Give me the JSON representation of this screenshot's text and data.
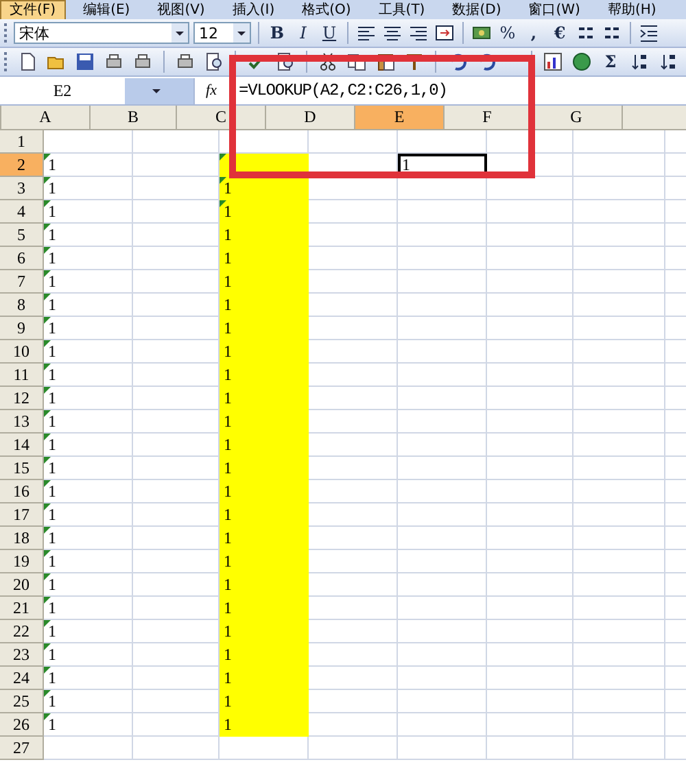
{
  "menu": [
    {
      "label": "文件(F)",
      "selected": true
    },
    {
      "label": "编辑(E)",
      "selected": false
    },
    {
      "label": "视图(V)",
      "selected": false
    },
    {
      "label": "插入(I)",
      "selected": false
    },
    {
      "label": "格式(O)",
      "selected": false
    },
    {
      "label": "工具(T)",
      "selected": false
    },
    {
      "label": "数据(D)",
      "selected": false
    },
    {
      "label": "窗口(W)",
      "selected": false
    },
    {
      "label": "帮助(H)",
      "selected": false
    }
  ],
  "format_toolbar": {
    "font": "宋体",
    "size": "12",
    "bold": "B",
    "italic": "I",
    "underline": "U",
    "percent": "%",
    "comma": ",",
    "euro": "€"
  },
  "standard_toolbar": {
    "autosum": "Σ"
  },
  "formula_bar": {
    "name_box": "E2",
    "fx": "fx",
    "formula": "=VLOOKUP(A2,C2:C26,1,0)"
  },
  "columns": [
    {
      "label": "A",
      "selected": false
    },
    {
      "label": "B",
      "selected": false
    },
    {
      "label": "C",
      "selected": false
    },
    {
      "label": "D",
      "selected": false
    },
    {
      "label": "E",
      "selected": true
    },
    {
      "label": "F",
      "selected": false
    },
    {
      "label": "G",
      "selected": false
    }
  ],
  "rows": [
    {
      "label": "1",
      "selected": false,
      "cells": {}
    },
    {
      "label": "2",
      "selected": true,
      "cells": {
        "A": {
          "text": "1",
          "flag": true
        },
        "C": {
          "flag": true,
          "highlighted": true
        },
        "E": {
          "text": "1",
          "active": true
        }
      }
    },
    {
      "label": "3",
      "selected": false,
      "cells": {
        "A": {
          "text": "1",
          "flag": true
        },
        "C": {
          "text": "1",
          "flag": true,
          "highlighted": true
        }
      }
    },
    {
      "label": "4",
      "selected": false,
      "cells": {
        "A": {
          "text": "1",
          "flag": true
        },
        "C": {
          "text": "1",
          "flag": true,
          "highlighted": true
        }
      }
    },
    {
      "label": "5",
      "selected": false,
      "cells": {
        "A": {
          "text": "1",
          "flag": true
        },
        "C": {
          "text": "1",
          "highlighted": true
        }
      }
    },
    {
      "label": "6",
      "selected": false,
      "cells": {
        "A": {
          "text": "1",
          "flag": true
        },
        "C": {
          "text": "1",
          "highlighted": true
        }
      }
    },
    {
      "label": "7",
      "selected": false,
      "cells": {
        "A": {
          "text": "1",
          "flag": true
        },
        "C": {
          "text": "1",
          "highlighted": true
        }
      }
    },
    {
      "label": "8",
      "selected": false,
      "cells": {
        "A": {
          "text": "1",
          "flag": true
        },
        "C": {
          "text": "1",
          "highlighted": true
        }
      }
    },
    {
      "label": "9",
      "selected": false,
      "cells": {
        "A": {
          "text": "1",
          "flag": true
        },
        "C": {
          "text": "1",
          "highlighted": true
        }
      }
    },
    {
      "label": "10",
      "selected": false,
      "cells": {
        "A": {
          "text": "1",
          "flag": true
        },
        "C": {
          "text": "1",
          "highlighted": true
        }
      }
    },
    {
      "label": "11",
      "selected": false,
      "cells": {
        "A": {
          "text": "1",
          "flag": true
        },
        "C": {
          "text": "1",
          "highlighted": true
        }
      }
    },
    {
      "label": "12",
      "selected": false,
      "cells": {
        "A": {
          "text": "1",
          "flag": true
        },
        "C": {
          "text": "1",
          "highlighted": true
        }
      }
    },
    {
      "label": "13",
      "selected": false,
      "cells": {
        "A": {
          "text": "1",
          "flag": true
        },
        "C": {
          "text": "1",
          "highlighted": true
        }
      }
    },
    {
      "label": "14",
      "selected": false,
      "cells": {
        "A": {
          "text": "1",
          "flag": true
        },
        "C": {
          "text": "1",
          "highlighted": true
        }
      }
    },
    {
      "label": "15",
      "selected": false,
      "cells": {
        "A": {
          "text": "1",
          "flag": true
        },
        "C": {
          "text": "1",
          "highlighted": true
        }
      }
    },
    {
      "label": "16",
      "selected": false,
      "cells": {
        "A": {
          "text": "1",
          "flag": true
        },
        "C": {
          "text": "1",
          "highlighted": true
        }
      }
    },
    {
      "label": "17",
      "selected": false,
      "cells": {
        "A": {
          "text": "1",
          "flag": true
        },
        "C": {
          "text": "1",
          "highlighted": true
        }
      }
    },
    {
      "label": "18",
      "selected": false,
      "cells": {
        "A": {
          "text": "1",
          "flag": true
        },
        "C": {
          "text": "1",
          "highlighted": true
        }
      }
    },
    {
      "label": "19",
      "selected": false,
      "cells": {
        "A": {
          "text": "1",
          "flag": true
        },
        "C": {
          "text": "1",
          "highlighted": true
        }
      }
    },
    {
      "label": "20",
      "selected": false,
      "cells": {
        "A": {
          "text": "1",
          "flag": true
        },
        "C": {
          "text": "1",
          "highlighted": true
        }
      }
    },
    {
      "label": "21",
      "selected": false,
      "cells": {
        "A": {
          "text": "1",
          "flag": true
        },
        "C": {
          "text": "1",
          "highlighted": true
        }
      }
    },
    {
      "label": "22",
      "selected": false,
      "cells": {
        "A": {
          "text": "1",
          "flag": true
        },
        "C": {
          "text": "1",
          "highlighted": true
        }
      }
    },
    {
      "label": "23",
      "selected": false,
      "cells": {
        "A": {
          "text": "1",
          "flag": true
        },
        "C": {
          "text": "1",
          "highlighted": true
        }
      }
    },
    {
      "label": "24",
      "selected": false,
      "cells": {
        "A": {
          "text": "1",
          "flag": true
        },
        "C": {
          "text": "1",
          "highlighted": true
        }
      }
    },
    {
      "label": "25",
      "selected": false,
      "cells": {
        "A": {
          "text": "1",
          "flag": true
        },
        "C": {
          "text": "1",
          "highlighted": true
        }
      }
    },
    {
      "label": "26",
      "selected": false,
      "cells": {
        "A": {
          "text": "1",
          "flag": true
        },
        "C": {
          "text": "1",
          "highlighted": true
        }
      }
    },
    {
      "label": "27",
      "selected": false,
      "cells": {}
    }
  ]
}
